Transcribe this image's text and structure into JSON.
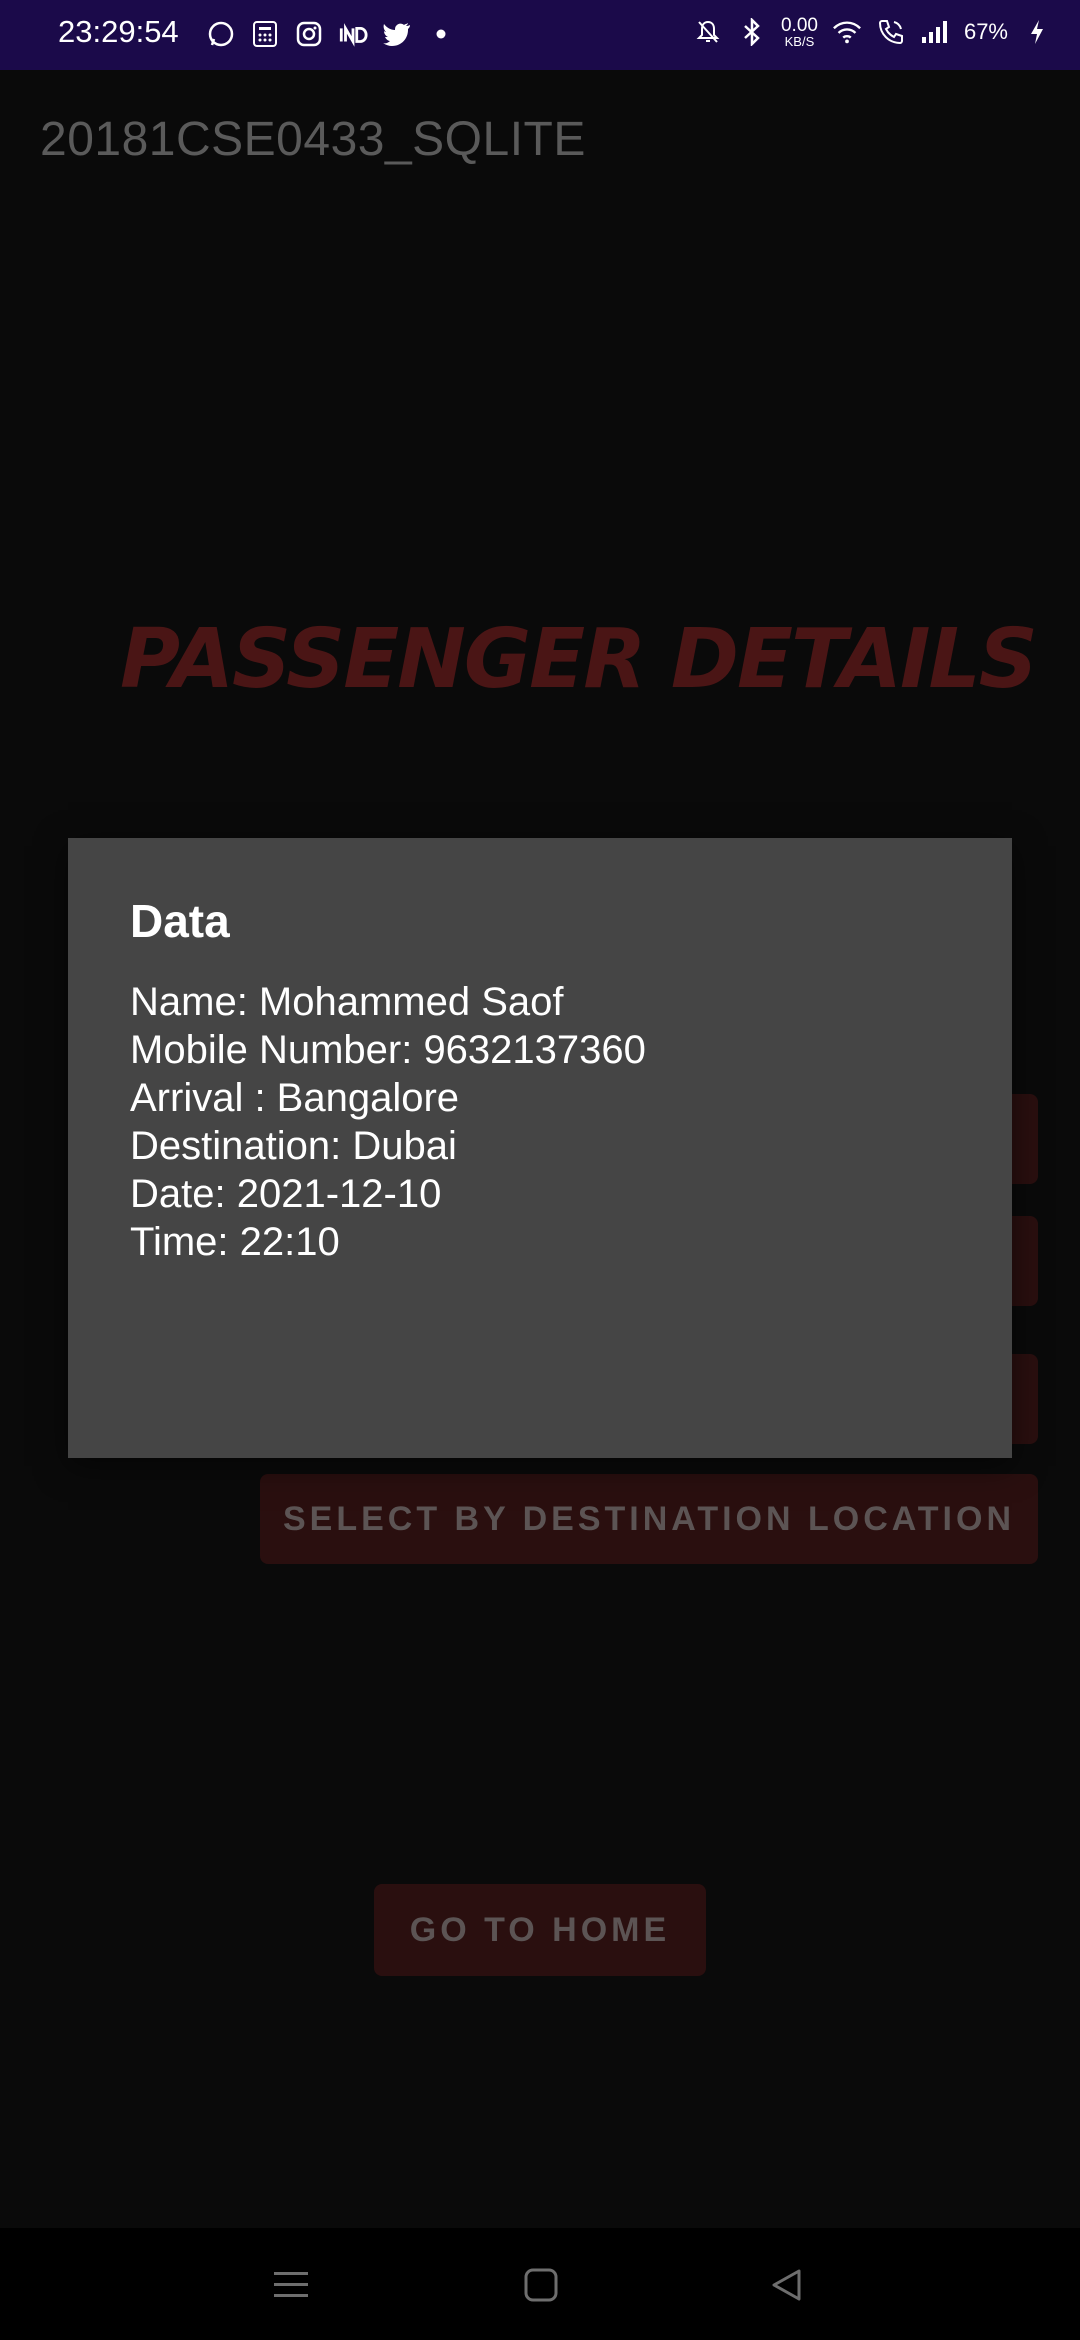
{
  "status_bar": {
    "time": "23:29:54",
    "net_speed_value": "0.00",
    "net_speed_unit": "KB/S",
    "battery": "67%",
    "left_icons": [
      "whatsapp-icon",
      "calculator-icon",
      "instagram-icon",
      "ind-icon",
      "twitter-icon",
      "dot-icon"
    ],
    "right_icons": [
      "bell-off-icon",
      "bluetooth-icon",
      "wifi-icon",
      "call-icon",
      "signal-icon",
      "charging-icon"
    ]
  },
  "app": {
    "title": "20181CSE0433_SQLITE"
  },
  "page": {
    "heading": "PASSENGER DETAILS",
    "accent_color": "#4a1515"
  },
  "buttons": {
    "select_by_destination": "SELECT BY DESTINATION LOCATION",
    "go_home": "GO TO HOME"
  },
  "dialog": {
    "title": "Data",
    "lines": [
      "Name: Mohammed Saof",
      "Mobile Number: 9632137360",
      "Arrival : Bangalore",
      "Destination: Dubai",
      "Date: 2021-12-10",
      "Time: 22:10"
    ]
  }
}
